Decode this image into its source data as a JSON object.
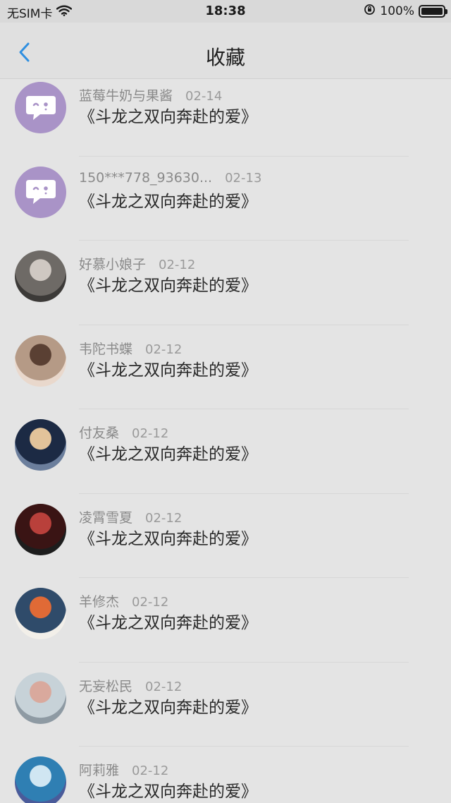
{
  "status_bar": {
    "carrier": "无SIM卡",
    "time": "18:38",
    "battery": "100%"
  },
  "nav": {
    "title": "收藏"
  },
  "items": [
    {
      "name": "蓝莓牛奶与果酱",
      "date": "02-14",
      "title": "《斗龙之双向奔赴的爱》",
      "avatar": "chat-bubble-icon"
    },
    {
      "name": "150***778_93630...",
      "date": "02-13",
      "title": "《斗龙之双向奔赴的爱》",
      "avatar": "chat-bubble-icon"
    },
    {
      "name": "好慕小娘子",
      "date": "02-12",
      "title": "《斗龙之双向奔赴的爱》",
      "avatar": "photo"
    },
    {
      "name": "韦陀书蝶",
      "date": "02-12",
      "title": "《斗龙之双向奔赴的爱》",
      "avatar": "photo"
    },
    {
      "name": "付友桑",
      "date": "02-12",
      "title": "《斗龙之双向奔赴的爱》",
      "avatar": "photo"
    },
    {
      "name": "凌霄雪夏",
      "date": "02-12",
      "title": "《斗龙之双向奔赴的爱》",
      "avatar": "photo"
    },
    {
      "name": "羊修杰",
      "date": "02-12",
      "title": "《斗龙之双向奔赴的爱》",
      "avatar": "photo"
    },
    {
      "name": "无妄松民",
      "date": "02-12",
      "title": "《斗龙之双向奔赴的爱》",
      "avatar": "photo"
    },
    {
      "name": "阿莉雅",
      "date": "02-12",
      "title": "《斗龙之双向奔赴的爱》",
      "avatar": "photo"
    }
  ],
  "colors": {
    "accent": "#2f8fe0",
    "default_avatar_bg": "#a993c7"
  }
}
